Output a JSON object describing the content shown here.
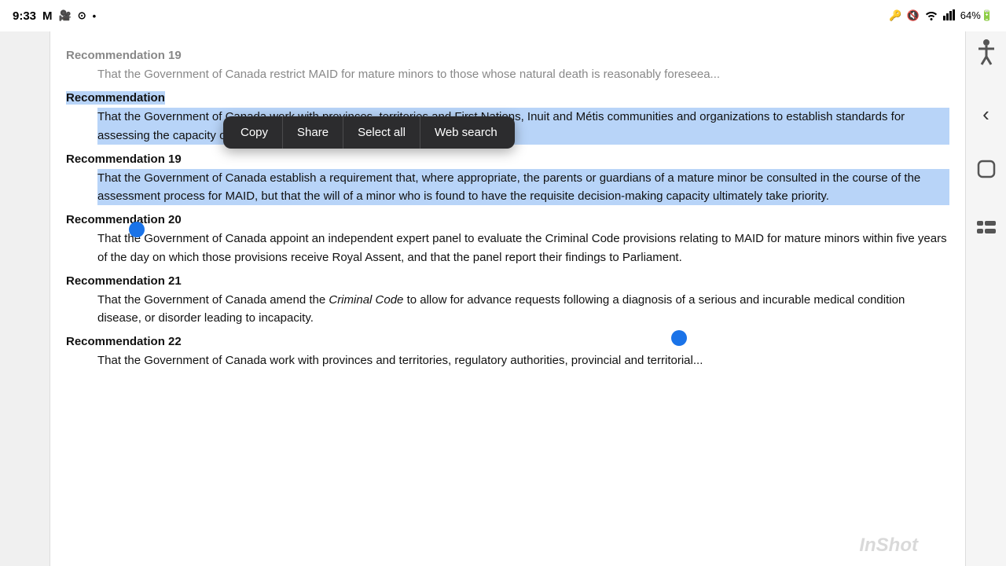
{
  "statusBar": {
    "time": "9:33",
    "icons": [
      "M",
      "📷",
      "⊙",
      "•"
    ],
    "rightIcons": [
      "🔑",
      "🔇",
      "WiFi",
      "Signal",
      "64%"
    ]
  },
  "contextMenu": {
    "items": [
      "Copy",
      "Share",
      "Select all",
      "Web search"
    ]
  },
  "document": {
    "partialTop": "Recommendation 19",
    "partialTopBody": "That the Government of Canada restrict MAID for mature minors to those whose natural death is reasonably foreseea...",
    "recommendation18Label": "Recommendation",
    "recommendation18Body": "That the Government of Canada work with provinces, territories and First Nations, Inuit and Métis communities and organizations to establish standards for assessing the capacity of mature minors seeking MAID.",
    "recommendation19Label": "Recommendation 19",
    "recommendation19Body": "That the Government of Canada establish a requirement that, where appropriate, the parents or guardians of a mature minor be consulted in the course of the assessment process for MAID, but that the will of a minor who is found to have the requisite decision-making capacity ultimately take priority.",
    "recommendation20Label": "Recommendation 20",
    "recommendation20Body": "That the Government of Canada appoint an independent expert panel to evaluate the Criminal Code provisions relating to MAID for mature minors within five years of the day on which those provisions receive Royal Assent, and that the panel report their findings to Parliament.",
    "recommendation21Label": "Recommendation 21",
    "recommendation21Body1": "That the Government of Canada amend the",
    "recommendation21ItalicText": "Criminal Code",
    "recommendation21Body2": "to allow for advance requests following a diagnosis of a serious and incurable medical condition disease, or disorder leading to incapacity.",
    "recommendation22Label": "Recommendation 22",
    "recommendation22Body": "That the Government of Canada work with provinces and territories, regulatory authorities, provincial and territorial..."
  },
  "watermark": "InShot"
}
